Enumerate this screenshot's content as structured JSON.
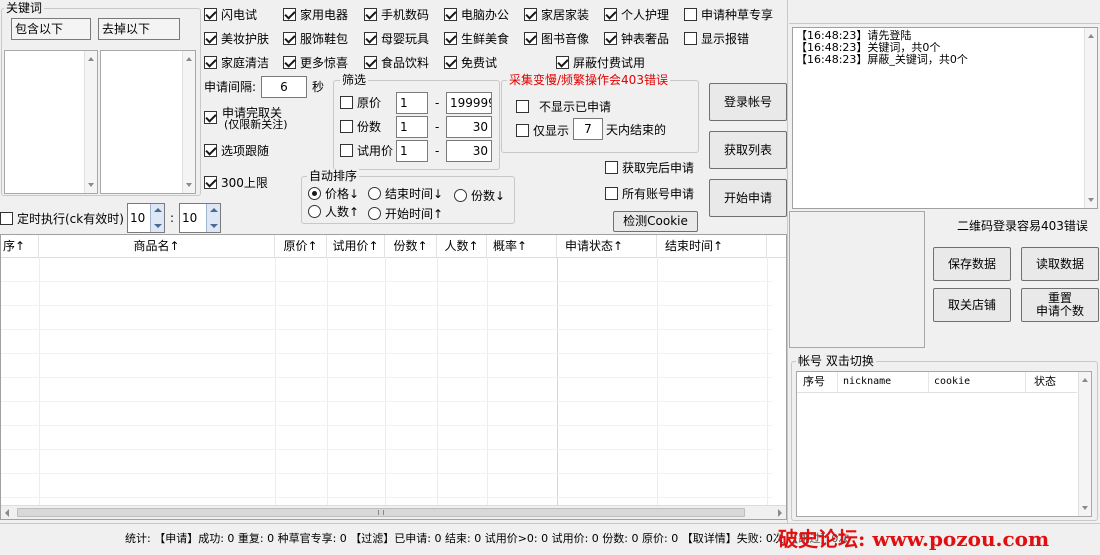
{
  "keywords": {
    "title": "关键词",
    "include_label": "包含以下",
    "exclude_label": "去掉以下"
  },
  "categories": [
    {
      "label": "闪电试",
      "checked": true
    },
    {
      "label": "家用电器",
      "checked": true
    },
    {
      "label": "手机数码",
      "checked": true
    },
    {
      "label": "电脑办公",
      "checked": true
    },
    {
      "label": "家居家装",
      "checked": true
    },
    {
      "label": "个人护理",
      "checked": true
    },
    {
      "label": "申请种草专享",
      "checked": false
    },
    {
      "label": "美妆护肤",
      "checked": true
    },
    {
      "label": "服饰鞋包",
      "checked": true
    },
    {
      "label": "母婴玩具",
      "checked": true
    },
    {
      "label": "生鲜美食",
      "checked": true
    },
    {
      "label": "图书音像",
      "checked": true
    },
    {
      "label": "钟表奢品",
      "checked": true
    },
    {
      "label": "显示报错",
      "checked": false
    },
    {
      "label": "家庭清洁",
      "checked": true
    },
    {
      "label": "更多惊喜",
      "checked": true
    },
    {
      "label": "食品饮料",
      "checked": true
    },
    {
      "label": "免费试",
      "checked": true
    },
    {
      "label": "屏蔽付费试用",
      "checked": true
    }
  ],
  "options": {
    "interval_label": "申请间隔:",
    "interval_value": "6",
    "interval_unit": "秒",
    "unfollow_line1": "申请完取关",
    "unfollow_line2": "(仅限新关注)",
    "unfollow_checked": true,
    "follow_label": "选项跟随",
    "follow_checked": true,
    "limit_label": "300上限",
    "limit_checked": true
  },
  "filter": {
    "title": "筛选",
    "rows": [
      {
        "label": "原价",
        "checked": false,
        "min": "1",
        "max": "199999"
      },
      {
        "label": "份数",
        "checked": false,
        "min": "1",
        "max": "30"
      },
      {
        "label": "试用价",
        "checked": false,
        "min": "1",
        "max": "30"
      }
    ],
    "dash": "-"
  },
  "warning": {
    "text": "采集变慢/频繁操作会403错误",
    "color": "#e00000",
    "hide_applied_label": "不显示已申请",
    "hide_applied_checked": false,
    "only_show_label": "仅显示",
    "only_show_checked": false,
    "days_value": "7",
    "days_suffix": "天内结束的"
  },
  "sort": {
    "title": "自动排序",
    "options": [
      {
        "label": "价格↓",
        "selected": true
      },
      {
        "label": "结束时间↓",
        "selected": false
      },
      {
        "label": "份数↓",
        "selected": false
      },
      {
        "label": "人数↑",
        "selected": false
      },
      {
        "label": "开始时间↑",
        "selected": false
      }
    ]
  },
  "after": {
    "fetch_then_apply": "获取完后申请",
    "fetch_then_apply_checked": false,
    "all_accounts": "所有账号申请",
    "all_accounts_checked": false,
    "check_cookie": "检测Cookie"
  },
  "buttons": {
    "login": "登录帐号",
    "get_list": "获取列表",
    "start_apply": "开始申请",
    "save_data": "保存数据",
    "read_data": "读取数据",
    "unfollow_store": "取关店铺",
    "reset_line1": "重置",
    "reset_line2": "申请个数"
  },
  "schedule": {
    "label": "定时执行(ck有效时)",
    "checked": false,
    "hour": "10",
    "separator": ":",
    "minute": "10"
  },
  "table": {
    "columns": [
      "序↑",
      "商品名↑",
      "原价↑",
      "试用价↑",
      "份数↑",
      "人数↑",
      "概率↑",
      "申请状态↑",
      "结束时间↑"
    ]
  },
  "log": {
    "lines": [
      "【16:48:23】请先登陆",
      "【16:48:23】关键词，共0个",
      "【16:48:23】屏蔽_关键词，共0个"
    ]
  },
  "qr": {
    "notice": "二维码登录容易403错误"
  },
  "accounts": {
    "title": "帐号 双击切换",
    "columns": [
      "序号",
      "nickname",
      "cookie",
      "状态"
    ]
  },
  "status": {
    "text": "统计: 【申请】成功: 0 重复: 0 种草官专享: 0 【过滤】已申请: 0 结束: 0 试用价>0: 0 试用价: 0 份数: 0 原价: 0 【取详情】失败: 0次 【跳过】0次",
    "watermark": "破史论坛: www.pozou.com"
  },
  "colors": {
    "warning": "#e00000",
    "watermark": "#e01010"
  }
}
